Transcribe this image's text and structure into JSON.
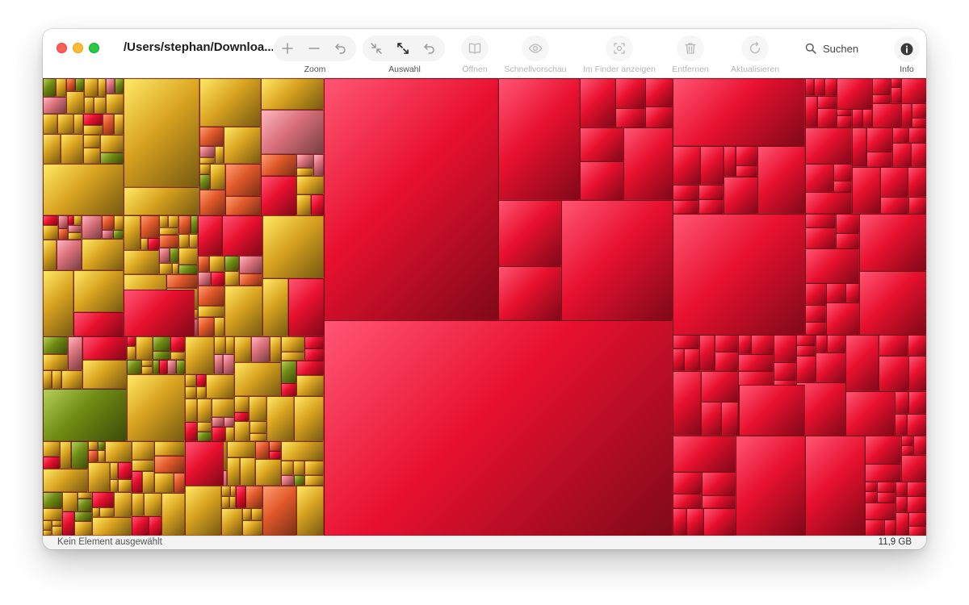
{
  "window": {
    "title": "/Users/stephan/Downloa..."
  },
  "toolbar": {
    "zoom_label": "Zoom",
    "selection_label": "Auswahl",
    "open_label": "Öffnen",
    "quicklook_label": "Schnellvorschau",
    "finder_label": "Im Finder anzeigen",
    "remove_label": "Entfernen",
    "refresh_label": "Aktualisieren",
    "search_placeholder": "Suchen",
    "info_label": "Info"
  },
  "status": {
    "selection_text": "Kein Element ausgewählt",
    "total_size": "11,9 GB"
  },
  "colors": {
    "red_tile": "#e8102e",
    "gold_tile": "#d9a320",
    "olive_tile": "#6f8a12",
    "pink_tile": "#d9707a",
    "orange_tile": "#e0582a",
    "traffic_red": "#fe5f57",
    "traffic_yellow": "#febc2e",
    "traffic_green": "#28c840"
  },
  "icons": {
    "zoom_in": "plus-icon",
    "zoom_out": "minus-icon",
    "zoom_back": "undo-arrow-icon",
    "select_shrink": "arrows-inward-icon",
    "select_expand": "arrows-outward-icon",
    "select_back": "undo-arrow-icon",
    "open": "book-icon",
    "quicklook": "eye-icon",
    "finder": "viewfinder-icon",
    "remove": "trash-icon",
    "refresh": "refresh-icon",
    "search": "magnifier-icon",
    "info": "info-circle-icon"
  }
}
